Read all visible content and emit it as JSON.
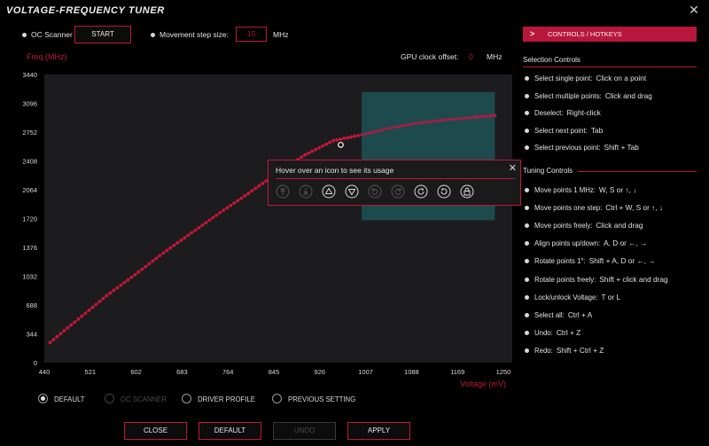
{
  "window": {
    "title": "VOLTAGE-FREQUENCY TUNER",
    "close": "✕"
  },
  "top_bar": {
    "oc_scanner_label": "OC Scanner",
    "start_label": "START",
    "step_label": "Movement step size:",
    "step_value": "15",
    "step_unit": "MHz"
  },
  "chart_header": {
    "gpu_offset_label": "GPU clock offset:",
    "gpu_offset_value": "0",
    "gpu_offset_unit": "MHz"
  },
  "chart_data": {
    "type": "scatter",
    "xlabel": "Voltage (mV)",
    "ylabel": "Freq (MHz)",
    "xlim": [
      440,
      1250
    ],
    "ylim": [
      0,
      3440
    ],
    "x_ticks": [
      "440",
      "521",
      "602",
      "683",
      "764",
      "845",
      "926",
      "1007",
      "1088",
      "1169",
      "1250"
    ],
    "y_ticks": [
      "3440",
      "3096",
      "2752",
      "2408",
      "2064",
      "1720",
      "1376",
      "1032",
      "688",
      "344",
      "0"
    ],
    "series": [
      {
        "color": "#c0173a",
        "x": [
          450,
          500,
          550,
          600,
          650,
          700,
          750,
          800,
          850,
          900,
          950,
          1000,
          1050,
          1100,
          1150,
          1200,
          1235
        ],
        "y": [
          240,
          520,
          800,
          1050,
          1310,
          1550,
          1790,
          2020,
          2260,
          2480,
          2650,
          2720,
          2800,
          2860,
          2900,
          2930,
          2950
        ]
      }
    ],
    "selected_point": {
      "x": 963,
      "y": 2600
    },
    "selection_region": {
      "x": [
        1000,
        1235
      ],
      "y": [
        1700,
        3230
      ]
    },
    "grid": false
  },
  "popup": {
    "text": "Hover over an icon to see its usage",
    "close": "✕"
  },
  "right_panel": {
    "header": "CONTROLS / HOTKEYS",
    "selection_title": "Selection Controls",
    "selection": [
      {
        "label": "Select single point:",
        "key": "Click on a point"
      },
      {
        "label": "Select multiple points:",
        "key": "Click and drag"
      },
      {
        "label": "Deselect:",
        "key": "Right-click"
      },
      {
        "label": "Select next point:",
        "key": "Tab"
      },
      {
        "label": "Select previous point:",
        "key": "Shift + Tab"
      }
    ],
    "tuning_title": "Tuning Controls",
    "tuning": [
      {
        "label": "Move points 1 MHz:",
        "key": "W, S or ↑, ↓"
      },
      {
        "label": "Move points one step:",
        "key": "Ctrl + W, S or ↑, ↓"
      },
      {
        "label": "Move points freely:",
        "key": "Click and drag"
      },
      {
        "label": "Align points up/down:",
        "key": "A, D or ←, →"
      },
      {
        "label": "Rotate points 1°:",
        "key": "Shift + A, D or ←, →"
      },
      {
        "label": "Rotate points freely:",
        "key": "Shift + click and drag"
      },
      {
        "label": "Lock/unlock Voltage:",
        "key": "T or L"
      },
      {
        "label": "Select all:",
        "key": "Ctrl + A"
      },
      {
        "label": "Undo:",
        "key": "Ctrl + Z"
      },
      {
        "label": "Redo:",
        "key": "Shift + Ctrl + Z"
      }
    ]
  },
  "profiles": [
    {
      "label": "DEFAULT",
      "selected": true,
      "disabled": false
    },
    {
      "label": "OC SCANNER",
      "selected": false,
      "disabled": true
    },
    {
      "label": "DRIVER PROFILE",
      "selected": false,
      "disabled": false
    },
    {
      "label": "PREVIOUS SETTING",
      "selected": false,
      "disabled": false
    }
  ],
  "actions": {
    "close": "CLOSE",
    "default": "DEFAULT",
    "undo": "UNDO",
    "apply": "APPLY"
  }
}
